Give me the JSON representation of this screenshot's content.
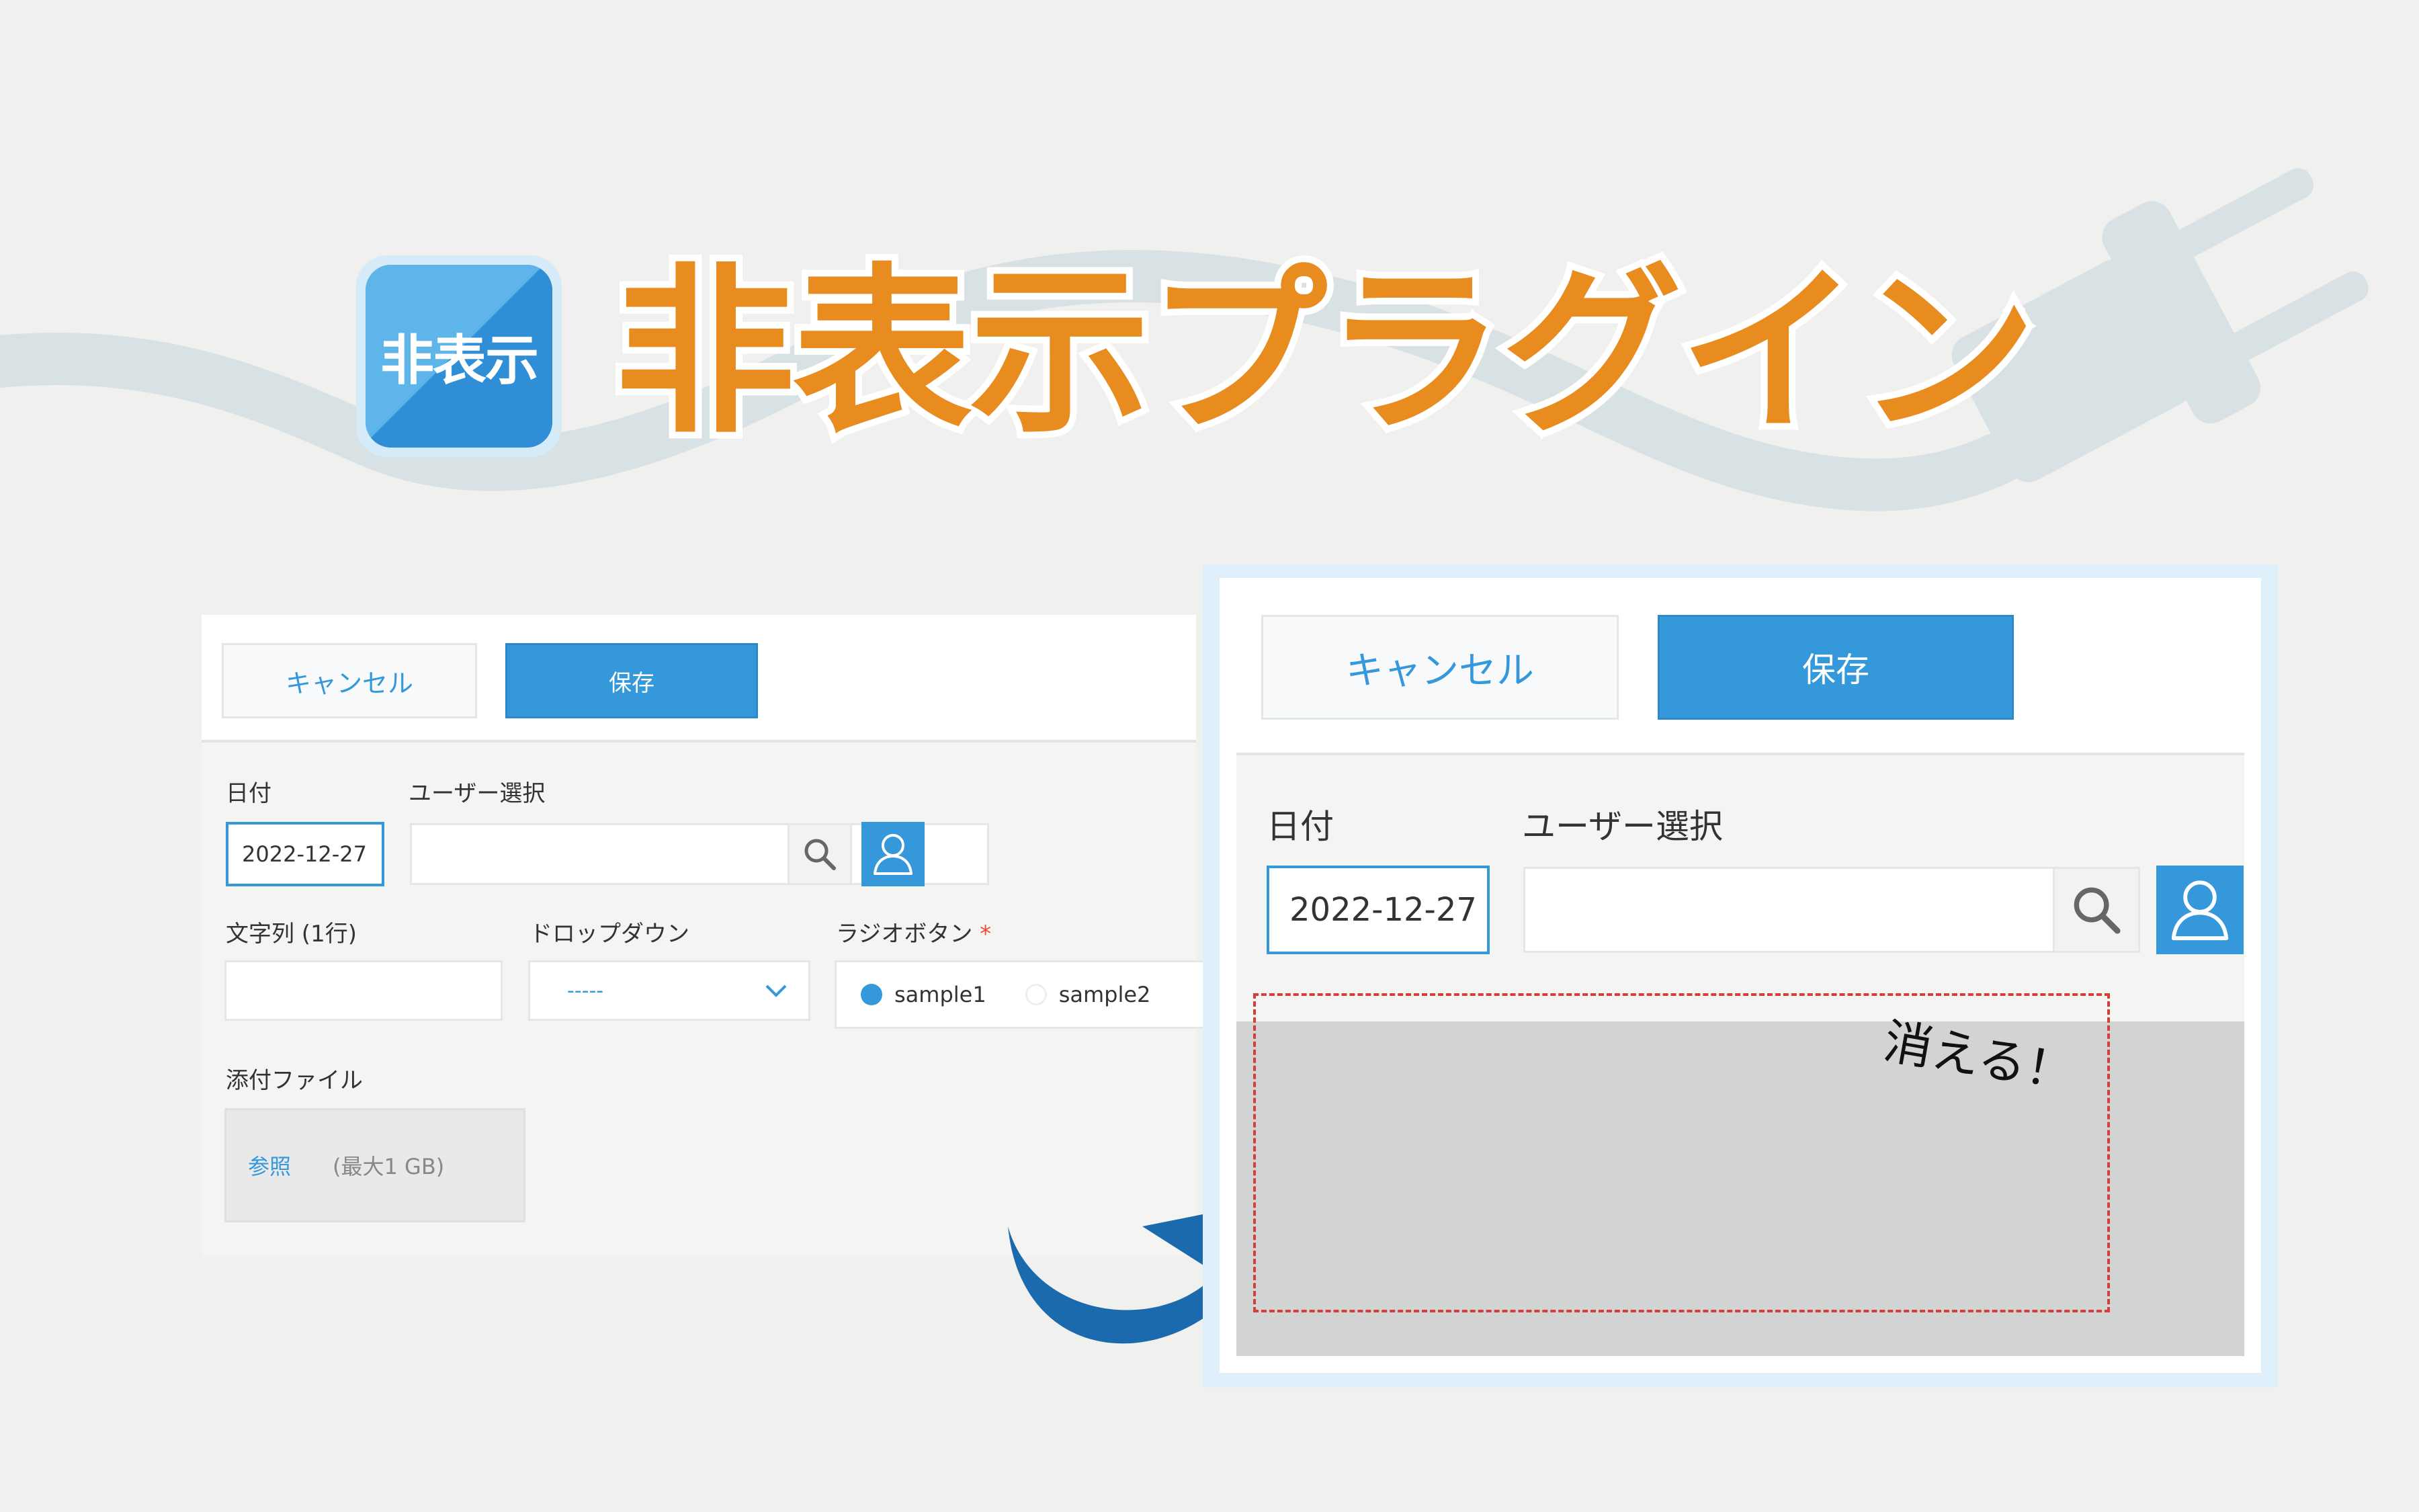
{
  "banner": {
    "icon_text": "非表示",
    "title": "非表示プラグイン"
  },
  "colors": {
    "title_orange": "#e98c20",
    "kintone_blue": "#3498db",
    "arrow_blue": "#1b6aad",
    "dashed_red": "#d63d3d"
  },
  "before_form": {
    "toolbar": {
      "cancel_label": "キャンセル",
      "save_label": "保存"
    },
    "date": {
      "label": "日付",
      "value": "2022-12-27"
    },
    "user_select": {
      "label": "ユーザー選択",
      "value": ""
    },
    "text_single": {
      "label": "文字列 (1行)",
      "value": ""
    },
    "dropdown": {
      "label": "ドロップダウン",
      "selected": "-----"
    },
    "radio": {
      "label": "ラジオボタン",
      "required_mark": "*",
      "options": [
        "sample1",
        "sample2"
      ],
      "selected": "sample1"
    },
    "attachment": {
      "label": "添付ファイル",
      "browse_label": "参照",
      "limit": "(最大1 GB)"
    }
  },
  "after_form": {
    "toolbar": {
      "cancel_label": "キャンセル",
      "save_label": "保存"
    },
    "date": {
      "label": "日付",
      "value": "2022-12-27"
    },
    "user_select": {
      "label": "ユーザー選択",
      "value": ""
    },
    "hidden_note": "消える！"
  },
  "icons": [
    "search-icon",
    "user-icon",
    "chevron-down-icon",
    "curved-arrow-icon",
    "plug-icon"
  ]
}
